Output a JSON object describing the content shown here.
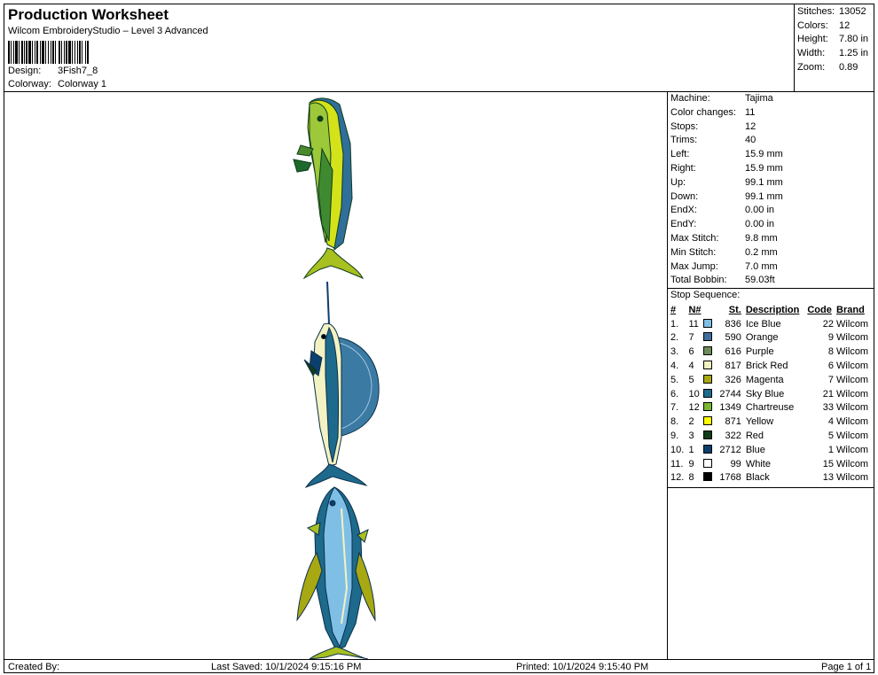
{
  "header": {
    "title": "Production Worksheet",
    "subtitle": "Wilcom EmbroideryStudio – Level 3 Advanced",
    "design_label": "Design:",
    "design_value": "3Fish7_8",
    "colorway_label": "Colorway:",
    "colorway_value": "Colorway 1"
  },
  "summary": [
    {
      "label": "Stitches:",
      "value": "13052"
    },
    {
      "label": "Colors:",
      "value": "12"
    },
    {
      "label": "Height:",
      "value": "7.80 in"
    },
    {
      "label": "Width:",
      "value": "1.25 in"
    },
    {
      "label": "Zoom:",
      "value": "0.89"
    }
  ],
  "details": [
    {
      "label": "Machine:",
      "value": "Tajima"
    },
    {
      "label": "Color changes:",
      "value": "11"
    },
    {
      "label": "Stops:",
      "value": "12"
    },
    {
      "label": "Trims:",
      "value": "40"
    },
    {
      "label": "Left:",
      "value": "15.9 mm"
    },
    {
      "label": "Right:",
      "value": "15.9 mm"
    },
    {
      "label": "Up:",
      "value": "99.1 mm"
    },
    {
      "label": "Down:",
      "value": "99.1 mm"
    },
    {
      "label": "EndX:",
      "value": "0.00 in"
    },
    {
      "label": "EndY:",
      "value": "0.00 in"
    },
    {
      "label": "Max Stitch:",
      "value": "9.8 mm"
    },
    {
      "label": "Min Stitch:",
      "value": "0.2 mm"
    },
    {
      "label": "Max Jump:",
      "value": "7.0 mm"
    },
    {
      "label": "Total Bobbin:",
      "value": "59.03ft"
    }
  ],
  "stop_sequence": {
    "title": "Stop Sequence:",
    "headers": {
      "num": "#",
      "n": "N#",
      "st": "St.",
      "desc": "Description",
      "code": "Code",
      "brand": "Brand"
    },
    "rows": [
      {
        "num": "1.",
        "n": "11",
        "color": "#7fbfe6",
        "st": "836",
        "desc": "Ice Blue",
        "code": "22",
        "brand": "Wilcom"
      },
      {
        "num": "2.",
        "n": "7",
        "color": "#3f6e9a",
        "st": "590",
        "desc": "Orange",
        "code": "9",
        "brand": "Wilcom"
      },
      {
        "num": "3.",
        "n": "6",
        "color": "#6f8a5c",
        "st": "616",
        "desc": "Purple",
        "code": "8",
        "brand": "Wilcom"
      },
      {
        "num": "4.",
        "n": "4",
        "color": "#f2f2c2",
        "st": "817",
        "desc": "Brick Red",
        "code": "6",
        "brand": "Wilcom"
      },
      {
        "num": "5.",
        "n": "5",
        "color": "#a8a813",
        "st": "326",
        "desc": "Magenta",
        "code": "7",
        "brand": "Wilcom"
      },
      {
        "num": "6.",
        "n": "10",
        "color": "#1e6a8c",
        "st": "2744",
        "desc": "Sky Blue",
        "code": "21",
        "brand": "Wilcom"
      },
      {
        "num": "7.",
        "n": "12",
        "color": "#7bb832",
        "st": "1349",
        "desc": "Chartreuse",
        "code": "33",
        "brand": "Wilcom"
      },
      {
        "num": "8.",
        "n": "2",
        "color": "#ffff00",
        "st": "871",
        "desc": "Yellow",
        "code": "4",
        "brand": "Wilcom"
      },
      {
        "num": "9.",
        "n": "3",
        "color": "#113d18",
        "st": "322",
        "desc": "Red",
        "code": "5",
        "brand": "Wilcom"
      },
      {
        "num": "10.",
        "n": "1",
        "color": "#0b3f6e",
        "st": "2712",
        "desc": "Blue",
        "code": "1",
        "brand": "Wilcom"
      },
      {
        "num": "11.",
        "n": "9",
        "color": "#ffffff",
        "st": "99",
        "desc": "White",
        "code": "15",
        "brand": "Wilcom"
      },
      {
        "num": "12.",
        "n": "8",
        "color": "#000000",
        "st": "1768",
        "desc": "Black",
        "code": "13",
        "brand": "Wilcom"
      }
    ]
  },
  "footer": {
    "created_by": "Created By:",
    "last_saved": "Last Saved: 10/1/2024 9:15:16 PM",
    "printed": "Printed: 10/1/2024 9:15:40 PM",
    "page": "Page 1 of 1"
  }
}
